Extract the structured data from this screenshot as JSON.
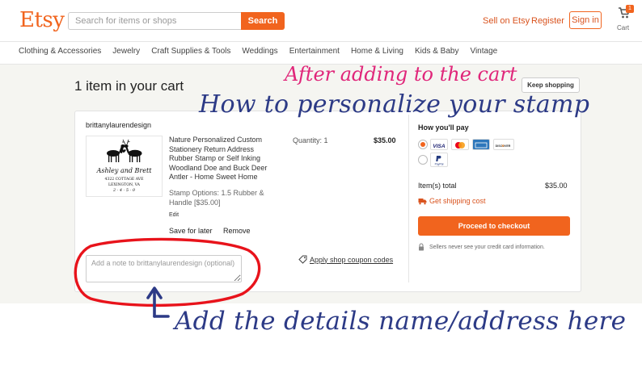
{
  "header": {
    "logo": "Etsy",
    "search_placeholder": "Search for items or shops",
    "search_button": "Search",
    "sell_link": "Sell on Etsy",
    "register_link": "Register",
    "signin_button": "Sign in",
    "cart_count": "1",
    "cart_label": "Cart"
  },
  "categories": [
    "Clothing & Accessories",
    "Jewelry",
    "Craft Supplies & Tools",
    "Weddings",
    "Entertainment",
    "Home & Living",
    "Kids & Baby",
    "Vintage"
  ],
  "cart": {
    "title": "1 item in your cart",
    "keep_shopping": "Keep shopping",
    "shop_name": "brittanylaurendesign",
    "item": {
      "title": "Nature Personalized Custom Stationery Return Address Rubber Stamp or Self Inking Woodland Doe and Buck Deer Antler - Home Sweet Home",
      "variation": "Stamp Options: 1.5 Rubber & Handle [$35.00]",
      "edit": "Edit",
      "quantity": "Quantity: 1",
      "price": "$35.00",
      "save_for_later": "Save for later",
      "remove": "Remove",
      "stamp_text": {
        "names": "Ashley and Brett",
        "street": "4322 COTTAGE AVE",
        "city": "LEXINGTON, VA",
        "zip": "2 · 4 · 5 · 0"
      }
    },
    "note_placeholder": "Add a note to brittanylaurendesign (optional)",
    "coupon_link": "Apply shop coupon codes",
    "payment": {
      "title": "How you'll pay",
      "card_logos": [
        "VISA",
        "MC",
        "AMEX",
        "DISCOVER"
      ],
      "paypal_logo": "PayPal",
      "items_total_label": "Item(s) total",
      "items_total": "$35.00",
      "shipping_link": "Get shipping cost",
      "checkout_button": "Proceed to checkout",
      "secure_note": "Sellers never see your credit card information."
    }
  },
  "annotations": {
    "top": "After adding to the cart",
    "middle": "How to personalize your stamp",
    "bottom": "Add the details name/address here"
  },
  "colors": {
    "accent": "#f1641e",
    "link": "#d9531e",
    "pink_annotation": "#e0267a",
    "navy_annotation": "#2c3a86",
    "red_circle": "#e8131b"
  }
}
